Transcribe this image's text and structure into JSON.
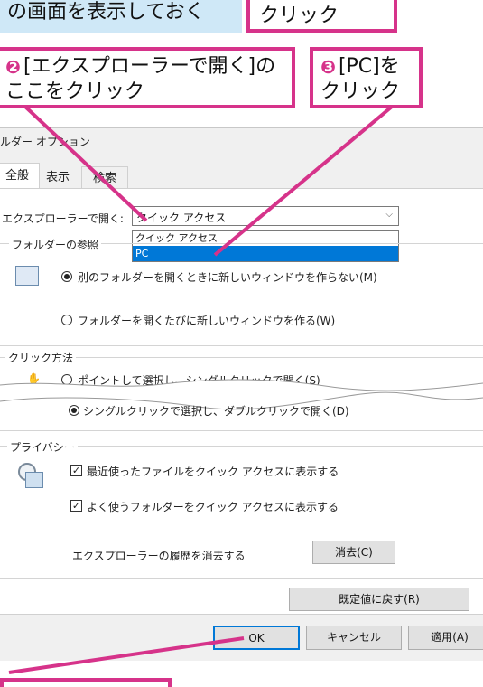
{
  "callouts": {
    "top_left": "の画面を表示しておく",
    "top_right": "クリック",
    "step2_num": "❷",
    "step2_line1": "[エクスプローラーで開く]の",
    "step2_line2": "ここをクリック",
    "step3_num": "❸",
    "step3_line1": "[PC]を",
    "step3_line2": "クリック"
  },
  "dialog": {
    "title": "ルダー オプション",
    "tabs": [
      "全般",
      "表示",
      "検索"
    ],
    "open_with_label": "エクスプローラーで開く:",
    "select_value": "クイック アクセス",
    "dropdown_options": [
      "クイック アクセス",
      "PC"
    ],
    "folder_browse_label": "フォルダーの参照",
    "radio_same_window": "別のフォルダーを開くときに新しいウィンドウを作らない(M)",
    "radio_new_window": "フォルダーを開くたびに新しいウィンドウを作る(W)",
    "click_method_label": "クリック方法",
    "radio_single_click": "ポイントして選択し、シングルクリックで開く(S)",
    "radio_double_click": "シングルクリックで選択し、ダブルクリックで開く(D)",
    "privacy_label": "プライバシー",
    "chk_recent_files": "最近使ったファイルをクイック アクセスに表示する",
    "chk_frequent_folders": "よく使うフォルダーをクイック アクセスに表示する",
    "clear_history_label": "エクスプローラーの履歴を消去する",
    "clear_button": "消去(C)",
    "restore_defaults_button": "既定値に戻す(R)",
    "ok_button": "OK",
    "cancel_button": "キャンセル",
    "apply_button": "適用(A)"
  },
  "colors": {
    "accent": "#d6338a",
    "selection": "#0078d7",
    "callout_blue": "#cfe8f7"
  }
}
